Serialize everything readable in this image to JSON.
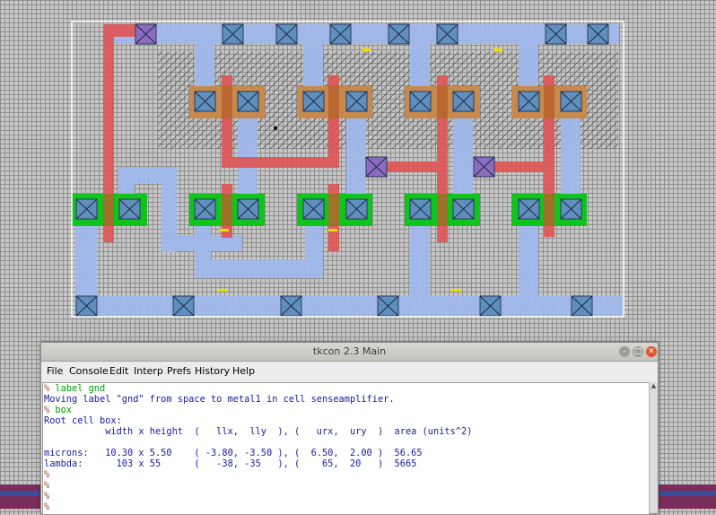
{
  "window": {
    "title": "tkcon 2.3 Main",
    "controls": {
      "minimize": "–",
      "maximize": "□",
      "close": "✕"
    }
  },
  "menu": [
    "File",
    "Console",
    "Edit",
    "Interp",
    "Prefs",
    "History",
    "Help"
  ],
  "console": {
    "prompt": "%",
    "lines": [
      {
        "prompt": "%",
        "cmd": "label gnd"
      },
      {
        "text": "Moving label \"gnd\" from space to metal1 in cell senseamplifier."
      },
      {
        "prompt": "%",
        "cmd": "box"
      },
      {
        "text": "Root cell box:"
      },
      {
        "text": "           width x height  (   llx,  lly  ), (   urx,  ury  )  area (units^2)"
      },
      {
        "text": ""
      },
      {
        "text": "microns:   10.30 x 5.50    ( -3.80, -3.50 ), (  6.50,  2.00 )  56.65"
      },
      {
        "text": "lambda:      103 x 55      (   -38, -35   ), (    65,  20   )  5665"
      },
      {
        "prompt": "%",
        "cmd": ""
      },
      {
        "prompt": "%",
        "cmd": ""
      },
      {
        "prompt": "%",
        "cmd": ""
      },
      {
        "prompt": "%",
        "cmd": ""
      }
    ]
  },
  "colors": {
    "metal1": "#9fb8ee",
    "poly": "#e05454",
    "diffusion": "#10c41e",
    "contact": "#5f8fbf",
    "via_contact": "#8b6cc0",
    "pdiff_contact": "#c68a4e",
    "selection_box": "#ffffff",
    "label": "#e6e000"
  }
}
